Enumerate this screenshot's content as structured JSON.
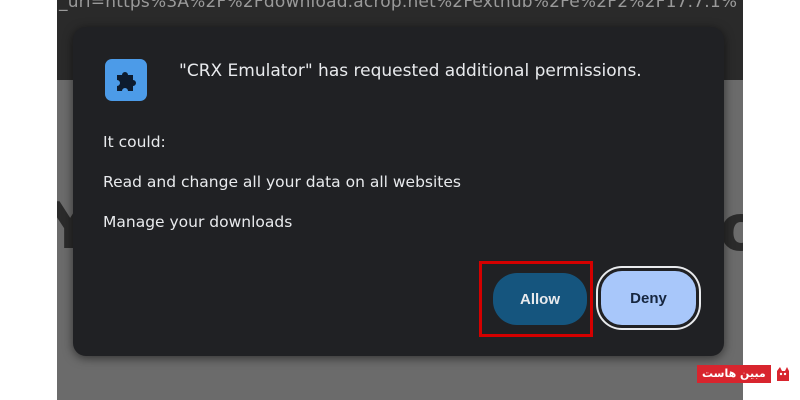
{
  "background": {
    "url_text": "_uri=https%3A%2F%2Fdownload.acrop.net%2Fextnub%2Fe%2F2%2F17.7.1%"
  },
  "dialog": {
    "title": "\"CRX Emulator\" has requested additional permissions.",
    "icon": "puzzle-piece-icon",
    "it_could_label": "It could:",
    "permissions": [
      "Read and change all your data on all websites",
      "Manage your downloads"
    ],
    "allow_label": "Allow",
    "deny_label": "Deny"
  },
  "watermark": {
    "text": "مبین هاست",
    "logo": "cat-logo-icon"
  },
  "colors": {
    "dialog_bg": "#202124",
    "allow_bg": "#15557e",
    "deny_bg": "#a8c7fa",
    "highlight": "#d40000",
    "icon_bg": "#4c9be8"
  }
}
